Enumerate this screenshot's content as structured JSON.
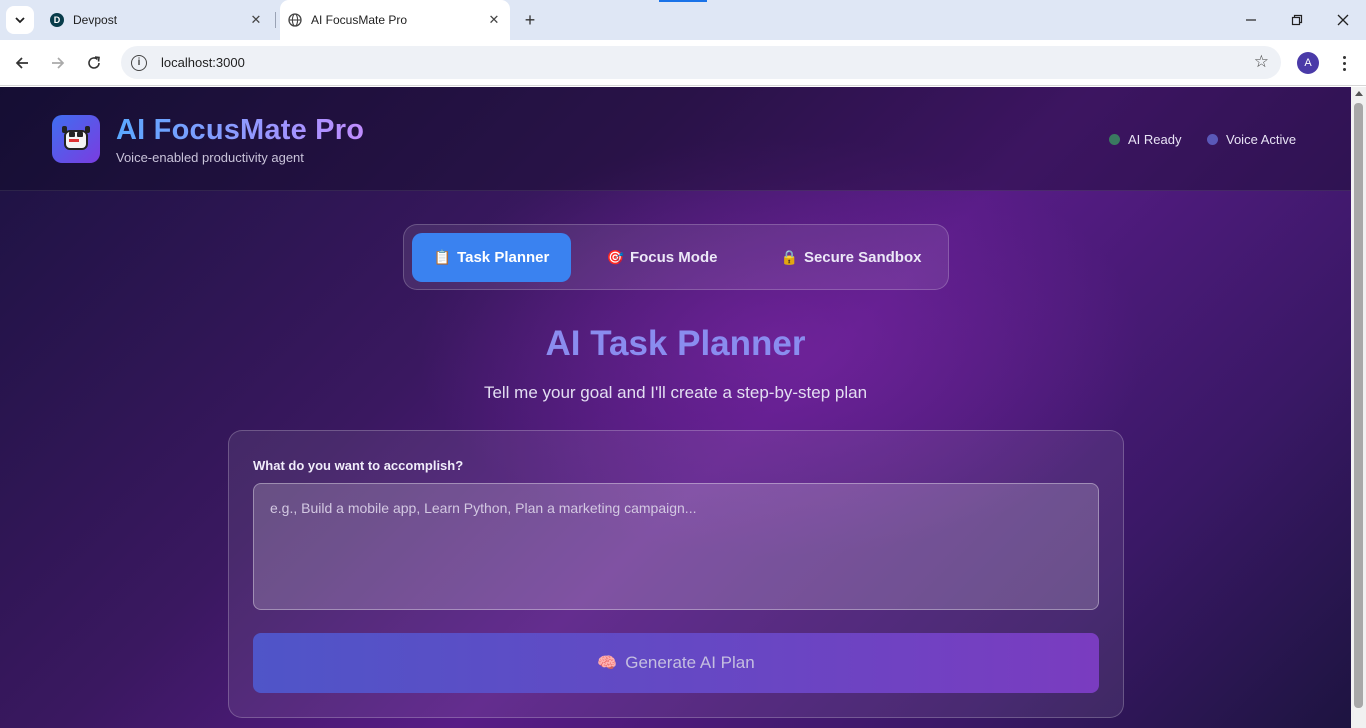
{
  "browser": {
    "tabs": [
      {
        "title": "Devpost",
        "favicon": "D"
      },
      {
        "title": "AI FocusMate Pro",
        "favicon": "globe"
      }
    ],
    "url": "localhost:3000",
    "profile_initial": "A"
  },
  "header": {
    "title": "AI FocusMate Pro",
    "subtitle": "Voice-enabled productivity agent",
    "statuses": [
      {
        "label": "AI Ready",
        "color": "#3ec486"
      },
      {
        "label": "Voice Active",
        "color": "#7e6bf0"
      }
    ]
  },
  "modes": [
    {
      "label": "Task Planner",
      "icon": "📋",
      "active": true
    },
    {
      "label": "Focus Mode",
      "icon": "🎯",
      "active": false
    },
    {
      "label": "Secure Sandbox",
      "icon": "🔒",
      "active": false
    }
  ],
  "planner": {
    "title": "AI Task Planner",
    "subtitle": "Tell me your goal and I'll create a step-by-step plan",
    "field_label": "What do you want to accomplish?",
    "placeholder": "e.g., Build a mobile app, Learn Python, Plan a marketing campaign...",
    "value": "",
    "button_label": "Generate AI Plan",
    "button_icon": "🧠"
  },
  "colors": {
    "accent": "#3a82f0",
    "title": "#8a8cef"
  }
}
